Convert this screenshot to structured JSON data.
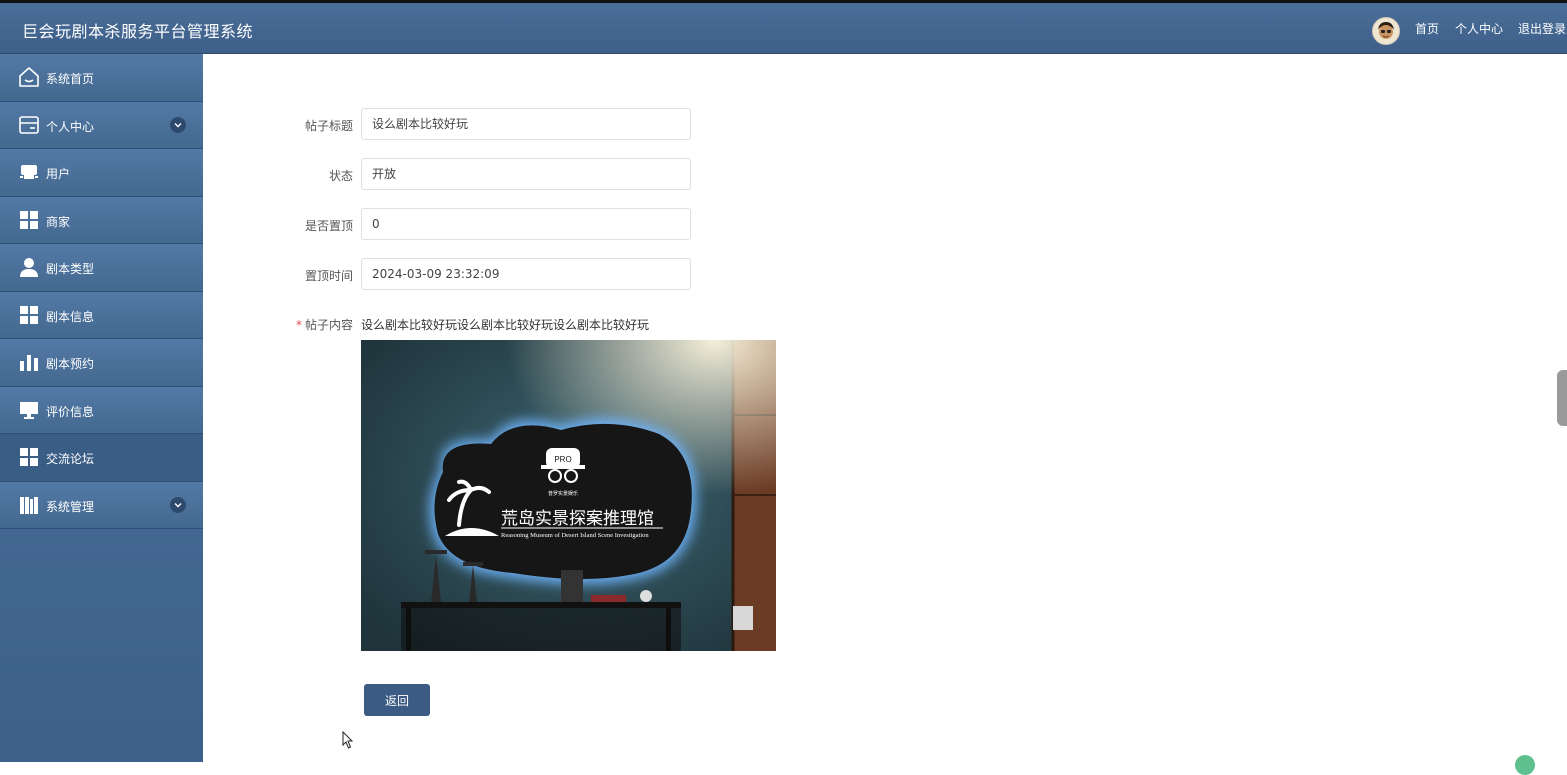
{
  "header": {
    "title": "巨会玩剧本杀服务平台管理系统",
    "links": {
      "home": "首页",
      "profile": "个人中心",
      "logout": "退出登录"
    }
  },
  "sidebar": {
    "items": [
      {
        "label": "系统首页",
        "icon": "home-icon"
      },
      {
        "label": "个人中心",
        "icon": "wallet-icon",
        "expandable": true
      },
      {
        "label": "用户",
        "icon": "printer-icon"
      },
      {
        "label": "商家",
        "icon": "grid-icon"
      },
      {
        "label": "剧本类型",
        "icon": "person-icon"
      },
      {
        "label": "剧本信息",
        "icon": "grid-icon"
      },
      {
        "label": "剧本预约",
        "icon": "bar-chart-icon"
      },
      {
        "label": "评价信息",
        "icon": "monitor-icon"
      },
      {
        "label": "交流论坛",
        "icon": "grid-icon",
        "active": true
      },
      {
        "label": "系统管理",
        "icon": "books-icon",
        "expandable": true
      }
    ]
  },
  "form": {
    "title_label": "帖子标题",
    "title_value": "设么剧本比较好玩",
    "status_label": "状态",
    "status_value": "开放",
    "pinned_label": "是否置顶",
    "pinned_value": "0",
    "pin_time_label": "置顶时间",
    "pin_time_value": "2024-03-09 23:32:09",
    "content_label": "帖子内容",
    "content_required_mark": "*",
    "content_text": "设么剧本比较好玩设么剧本比较好玩设么剧本比较好玩"
  },
  "photo": {
    "brand_badge": "PRO",
    "brand_sub": "普罗实景娱乐",
    "sign_cn": "荒岛实景探案推理馆",
    "sign_en": "Reasoning Museum of Desert Island Scene Investigation"
  },
  "actions": {
    "back_label": "返回"
  },
  "colors": {
    "header": "#4b6f9a",
    "sidebar": "#4f76a3",
    "button": "#3b5a84"
  }
}
